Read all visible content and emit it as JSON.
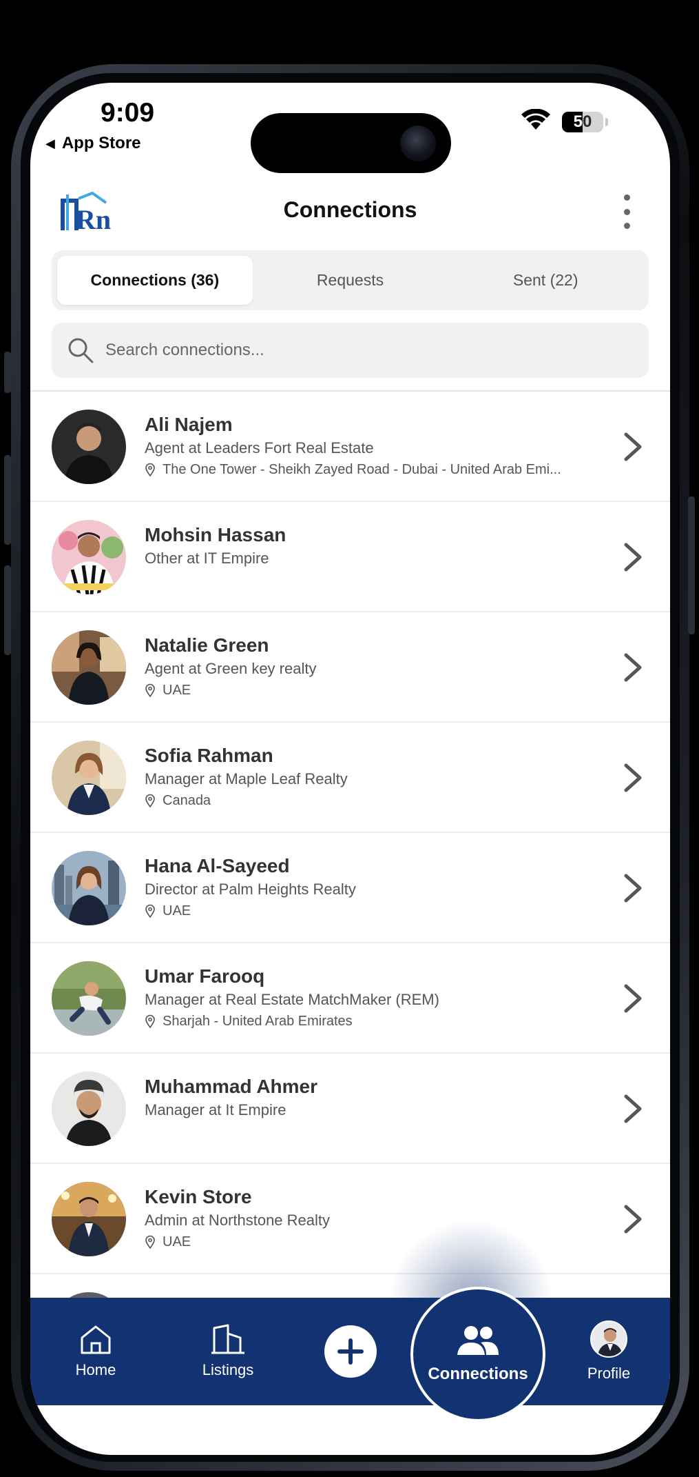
{
  "status_bar": {
    "time": "9:09",
    "back_app": "App Store",
    "battery": "50"
  },
  "header": {
    "logo_text": "Rn",
    "title": "Connections"
  },
  "tabs": [
    {
      "label": "Connections (36)",
      "active": true
    },
    {
      "label": "Requests",
      "active": false
    },
    {
      "label": "Sent (22)",
      "active": false
    }
  ],
  "search": {
    "placeholder": "Search connections..."
  },
  "connections": [
    {
      "name": "Ali Najem",
      "role": "Agent at Leaders Fort Real Estate",
      "location": "The One Tower - Sheikh Zayed Road - Dubai - United Arab Emi..."
    },
    {
      "name": "Mohsin Hassan",
      "role": "Other at IT Empire",
      "location": ""
    },
    {
      "name": "Natalie Green",
      "role": "Agent at Green key realty",
      "location": "UAE"
    },
    {
      "name": "Sofia Rahman",
      "role": "Manager at Maple Leaf Realty",
      "location": "Canada"
    },
    {
      "name": "Hana Al-Sayeed",
      "role": "Director at Palm Heights Realty",
      "location": "UAE"
    },
    {
      "name": "Umar Farooq",
      "role": "Manager at Real Estate MatchMaker (REM)",
      "location": "Sharjah - United Arab Emirates"
    },
    {
      "name": "Muhammad Ahmer",
      "role": "Manager at It Empire",
      "location": ""
    },
    {
      "name": "Kevin Store",
      "role": "Admin at Northstone Realty",
      "location": "UAE"
    }
  ],
  "nav": {
    "home": "Home",
    "listings": "Listings",
    "connections": "Connections",
    "profile": "Profile"
  },
  "colors": {
    "brand_navy": "#123272",
    "logo_blue": "#1a4fa0",
    "logo_sky": "#3fa9e0"
  }
}
